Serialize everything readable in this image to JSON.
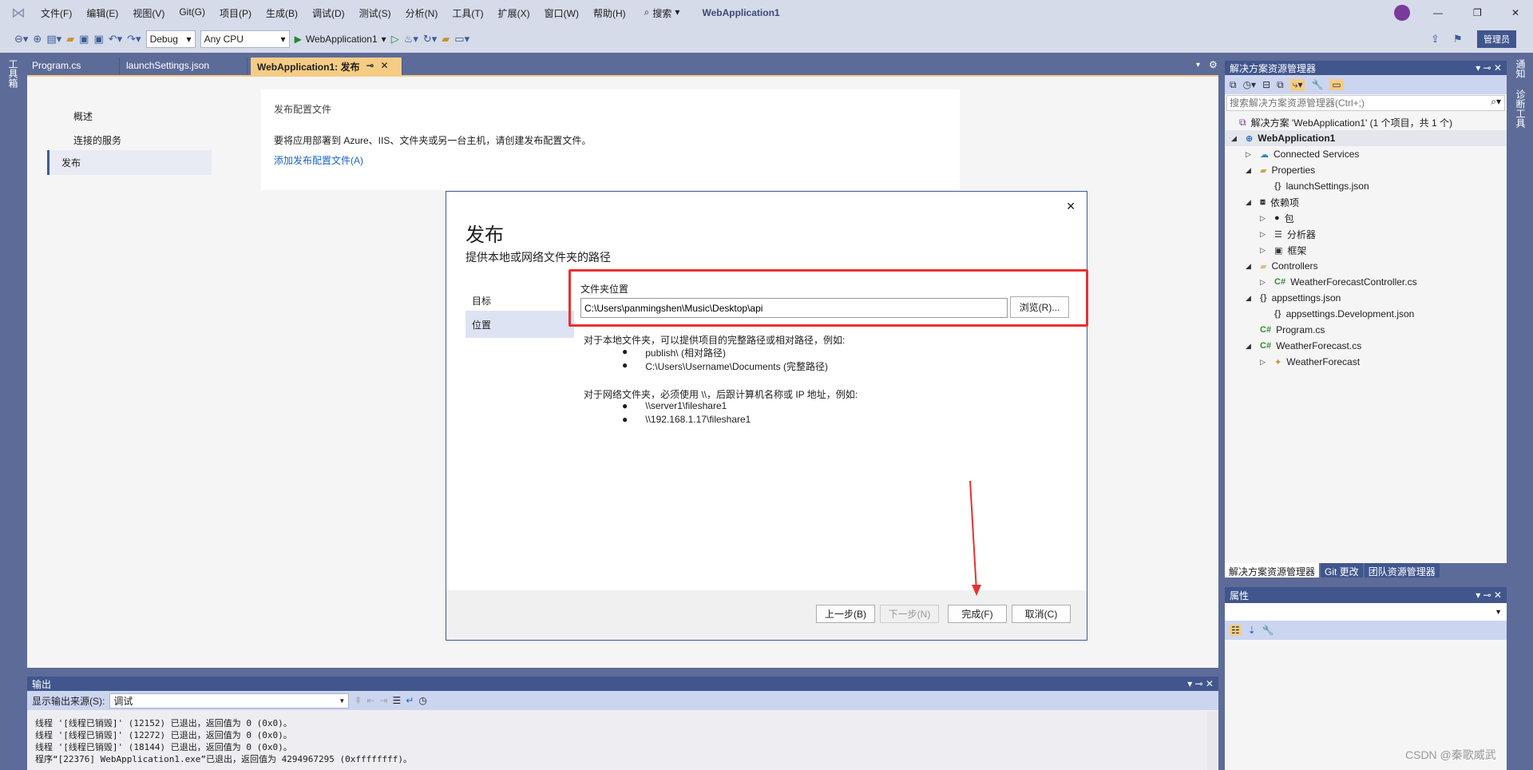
{
  "menu": [
    "文件(F)",
    "编辑(E)",
    "视图(V)",
    "Git(G)",
    "项目(P)",
    "生成(B)",
    "调试(D)",
    "测试(S)",
    "分析(N)",
    "工具(T)",
    "扩展(X)",
    "窗口(W)",
    "帮助(H)"
  ],
  "search_label": "搜索",
  "window_title": "WebApplication1",
  "admin_label": "管理员",
  "toolbar": {
    "config": "Debug",
    "platform": "Any CPU",
    "run_target": "WebApplication1"
  },
  "left_strip": "工具箱",
  "right_strip": [
    "通知",
    "诊断工具"
  ],
  "tabs": [
    {
      "label": "Program.cs"
    },
    {
      "label": "launchSettings.json"
    },
    {
      "label": "WebApplication1: 发布",
      "active": true
    }
  ],
  "page_nav": [
    "概述",
    "连接的服务",
    "发布"
  ],
  "card": {
    "title": "发布配置文件",
    "text": "要将应用部署到 Azure、IIS、文件夹或另一台主机，请创建发布配置文件。",
    "link": "添加发布配置文件(A)"
  },
  "dialog": {
    "title": "发布",
    "subtitle": "提供本地或网络文件夹的路径",
    "steps": [
      "目标",
      "位置"
    ],
    "field_label": "文件夹位置",
    "path": "C:\\Users\\panmingshen\\Music\\Desktop\\api",
    "browse": "浏览(R)...",
    "local_hint": "对于本地文件夹，可以提供项目的完整路径或相对路径，例如:",
    "local_examples": [
      "publish\\ (相对路径)",
      "C:\\Users\\Username\\Documents (完整路径)"
    ],
    "net_hint": "对于网络文件夹，必须使用 \\\\，后跟计算机名称或 IP 地址，例如:",
    "net_examples": [
      "\\\\server1\\fileshare1",
      "\\\\192.168.1.17\\fileshare1"
    ],
    "buttons": {
      "back": "上一步(B)",
      "next": "下一步(N)",
      "finish": "完成(F)",
      "cancel": "取消(C)"
    },
    "highlight_color": "#e8312f"
  },
  "solution": {
    "title": "解决方案资源管理器",
    "search_placeholder": "搜索解决方案资源管理器(Ctrl+;)",
    "root": "解决方案 'WebApplication1' (1 个项目，共 1 个)",
    "items": [
      {
        "label": "WebApplication1",
        "indent": 0,
        "exp": "◢",
        "bold": true,
        "icon": "project-icon"
      },
      {
        "label": "Connected Services",
        "indent": 1,
        "exp": "▷",
        "icon": "cloud-icon"
      },
      {
        "label": "Properties",
        "indent": 1,
        "exp": "◢",
        "icon": "folder-wrench-icon"
      },
      {
        "label": "launchSettings.json",
        "indent": 2,
        "exp": "",
        "icon": "json-icon"
      },
      {
        "label": "依赖项",
        "indent": 1,
        "exp": "◢",
        "icon": "dependencies-icon"
      },
      {
        "label": "包",
        "indent": 2,
        "exp": "▷",
        "icon": "package-icon"
      },
      {
        "label": "分析器",
        "indent": 2,
        "exp": "▷",
        "icon": "analyzer-icon"
      },
      {
        "label": "框架",
        "indent": 2,
        "exp": "▷",
        "icon": "framework-icon"
      },
      {
        "label": "Controllers",
        "indent": 1,
        "exp": "◢",
        "icon": "folder-icon"
      },
      {
        "label": "WeatherForecastController.cs",
        "indent": 2,
        "exp": "▷",
        "icon": "csharp-icon"
      },
      {
        "label": "appsettings.json",
        "indent": 1,
        "exp": "◢",
        "icon": "json-icon"
      },
      {
        "label": "appsettings.Development.json",
        "indent": 2,
        "exp": "",
        "icon": "json-icon"
      },
      {
        "label": "Program.cs",
        "indent": 1,
        "exp": "",
        "icon": "csharp-icon"
      },
      {
        "label": "WeatherForecast.cs",
        "indent": 1,
        "exp": "◢",
        "icon": "csharp-icon"
      },
      {
        "label": "WeatherForecast",
        "indent": 2,
        "exp": "▷",
        "icon": "class-icon"
      }
    ],
    "bottom_tabs": [
      "解决方案资源管理器",
      "Git 更改",
      "团队资源管理器"
    ]
  },
  "properties": {
    "title": "属性"
  },
  "output": {
    "title": "输出",
    "source_label": "显示输出来源(S):",
    "source": "调试",
    "lines": [
      "线程 '[线程已销毁]' (12152) 已退出，返回值为 0 (0x0)。",
      "线程 '[线程已销毁]' (12272) 已退出，返回值为 0 (0x0)。",
      "线程 '[线程已销毁]' (18144) 已退出，返回值为 0 (0x0)。",
      "程序“[22376] WebApplication1.exe”已退出，返回值为 4294967295 (0xffffffff)。"
    ]
  },
  "watermark": "CSDN @秦歌威武"
}
